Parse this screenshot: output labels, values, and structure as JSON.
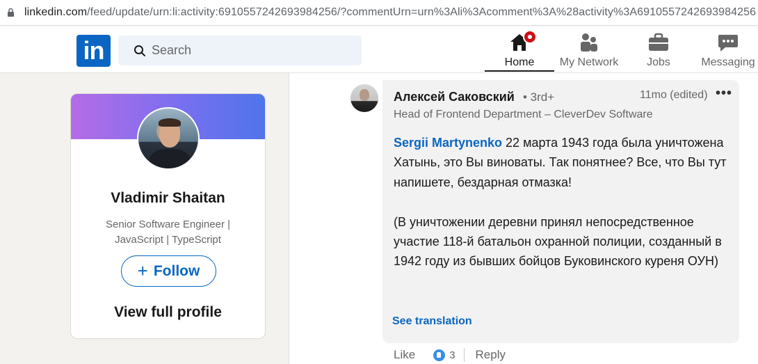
{
  "browser": {
    "url_host": "linkedin.com",
    "url_path": "/feed/update/urn:li:activity:6910557242693984256/?commentUrn=urn%3Ali%3Acomment%3A%28activity%3A6910557242693984256"
  },
  "nav": {
    "logo": "in",
    "search_placeholder": "Search",
    "items": [
      {
        "label": "Home",
        "icon": "home-icon"
      },
      {
        "label": "My Network",
        "icon": "network-icon"
      },
      {
        "label": "Jobs",
        "icon": "briefcase-icon"
      },
      {
        "label": "Messaging",
        "icon": "messaging-icon"
      }
    ]
  },
  "profile_card": {
    "name": "Vladimir Shaitan",
    "headline": "Senior Software Engineer | JavaScript | TypeScript",
    "follow_label": "Follow",
    "view_profile_label": "View full profile",
    "banner_gradient": [
      "#b56ce6",
      "#4f75ea"
    ]
  },
  "comment": {
    "author": "Алексей Саковский",
    "degree": "• 3rd+",
    "time": "11mo (edited)",
    "more": "•••",
    "author_title": "Head of Frontend Department – CleverDev Software",
    "mention": "Sergii Martynenko",
    "paragraph1_rest": " 22 марта 1943 года была уничтожена Хатынь, это Вы виноваты. Так понятнее? Все, что Вы тут напишете, бездарная отмазка!",
    "paragraph2": "(В уничтожении деревни принял непосредственное участие 118-й батальон охранной полиции, созданный в 1942 году из бывших бойцов Буковинского куреня ОУН)",
    "see_translation": "See translation"
  },
  "actions": {
    "like": "Like",
    "reaction_count": "3",
    "reply": "Reply"
  },
  "colors": {
    "brand": "#0a66c2",
    "notification": "#cc1016",
    "page_bg": "#f4f2ee"
  }
}
